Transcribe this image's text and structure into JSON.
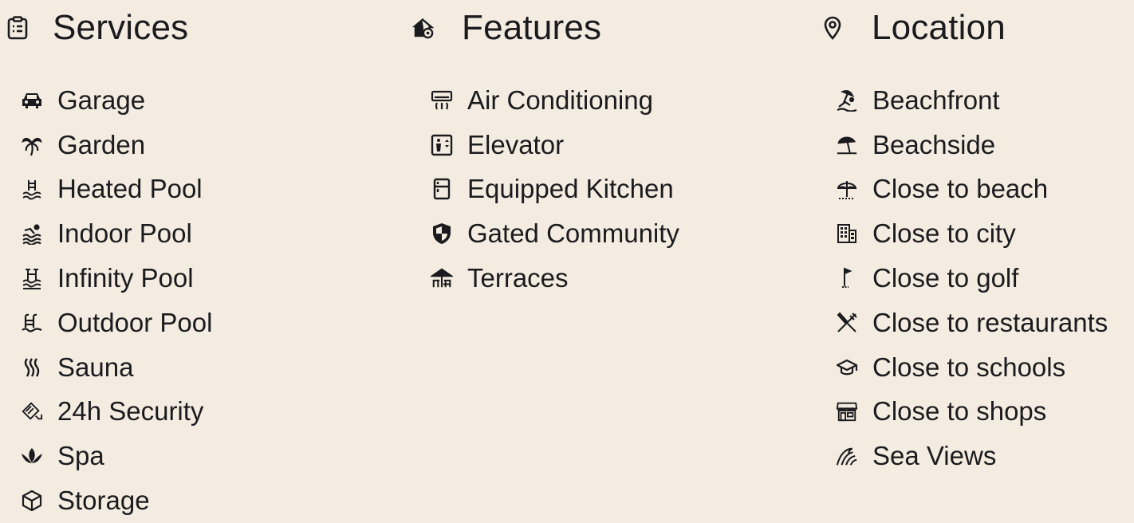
{
  "services": {
    "title": "Services",
    "icon": "clipboard-icon",
    "items": [
      {
        "label": "Garage",
        "icon": "car-icon"
      },
      {
        "label": "Garden",
        "icon": "palm-tree-icon"
      },
      {
        "label": "Heated Pool",
        "icon": "heated-pool-icon"
      },
      {
        "label": "Indoor Pool",
        "icon": "swimmer-icon"
      },
      {
        "label": "Infinity Pool",
        "icon": "infinity-pool-icon"
      },
      {
        "label": "Outdoor Pool",
        "icon": "pool-ladder-icon"
      },
      {
        "label": "Sauna",
        "icon": "steam-icon"
      },
      {
        "label": "24h Security",
        "icon": "security-camera-icon"
      },
      {
        "label": "Spa",
        "icon": "lotus-icon"
      },
      {
        "label": "Storage",
        "icon": "box-icon"
      }
    ]
  },
  "features": {
    "title": "Features",
    "icon": "house-gear-icon",
    "items": [
      {
        "label": "Air Conditioning",
        "icon": "air-conditioner-icon"
      },
      {
        "label": "Elevator",
        "icon": "elevator-icon"
      },
      {
        "label": "Equipped Kitchen",
        "icon": "fridge-icon"
      },
      {
        "label": "Gated Community",
        "icon": "shield-icon"
      },
      {
        "label": "Terraces",
        "icon": "terrace-icon"
      }
    ]
  },
  "location": {
    "title": "Location",
    "icon": "map-pin-icon",
    "items": [
      {
        "label": "Beachfront",
        "icon": "beach-person-icon"
      },
      {
        "label": "Beachside",
        "icon": "beach-umbrella-icon"
      },
      {
        "label": "Close to beach",
        "icon": "parasol-icon"
      },
      {
        "label": "Close to city",
        "icon": "building-icon"
      },
      {
        "label": "Close to golf",
        "icon": "golf-flag-icon"
      },
      {
        "label": "Close to restaurants",
        "icon": "utensils-icon"
      },
      {
        "label": "Close to schools",
        "icon": "graduation-cap-icon"
      },
      {
        "label": "Close to shops",
        "icon": "shop-icon"
      },
      {
        "label": "Sea Views",
        "icon": "wave-icon"
      }
    ]
  }
}
